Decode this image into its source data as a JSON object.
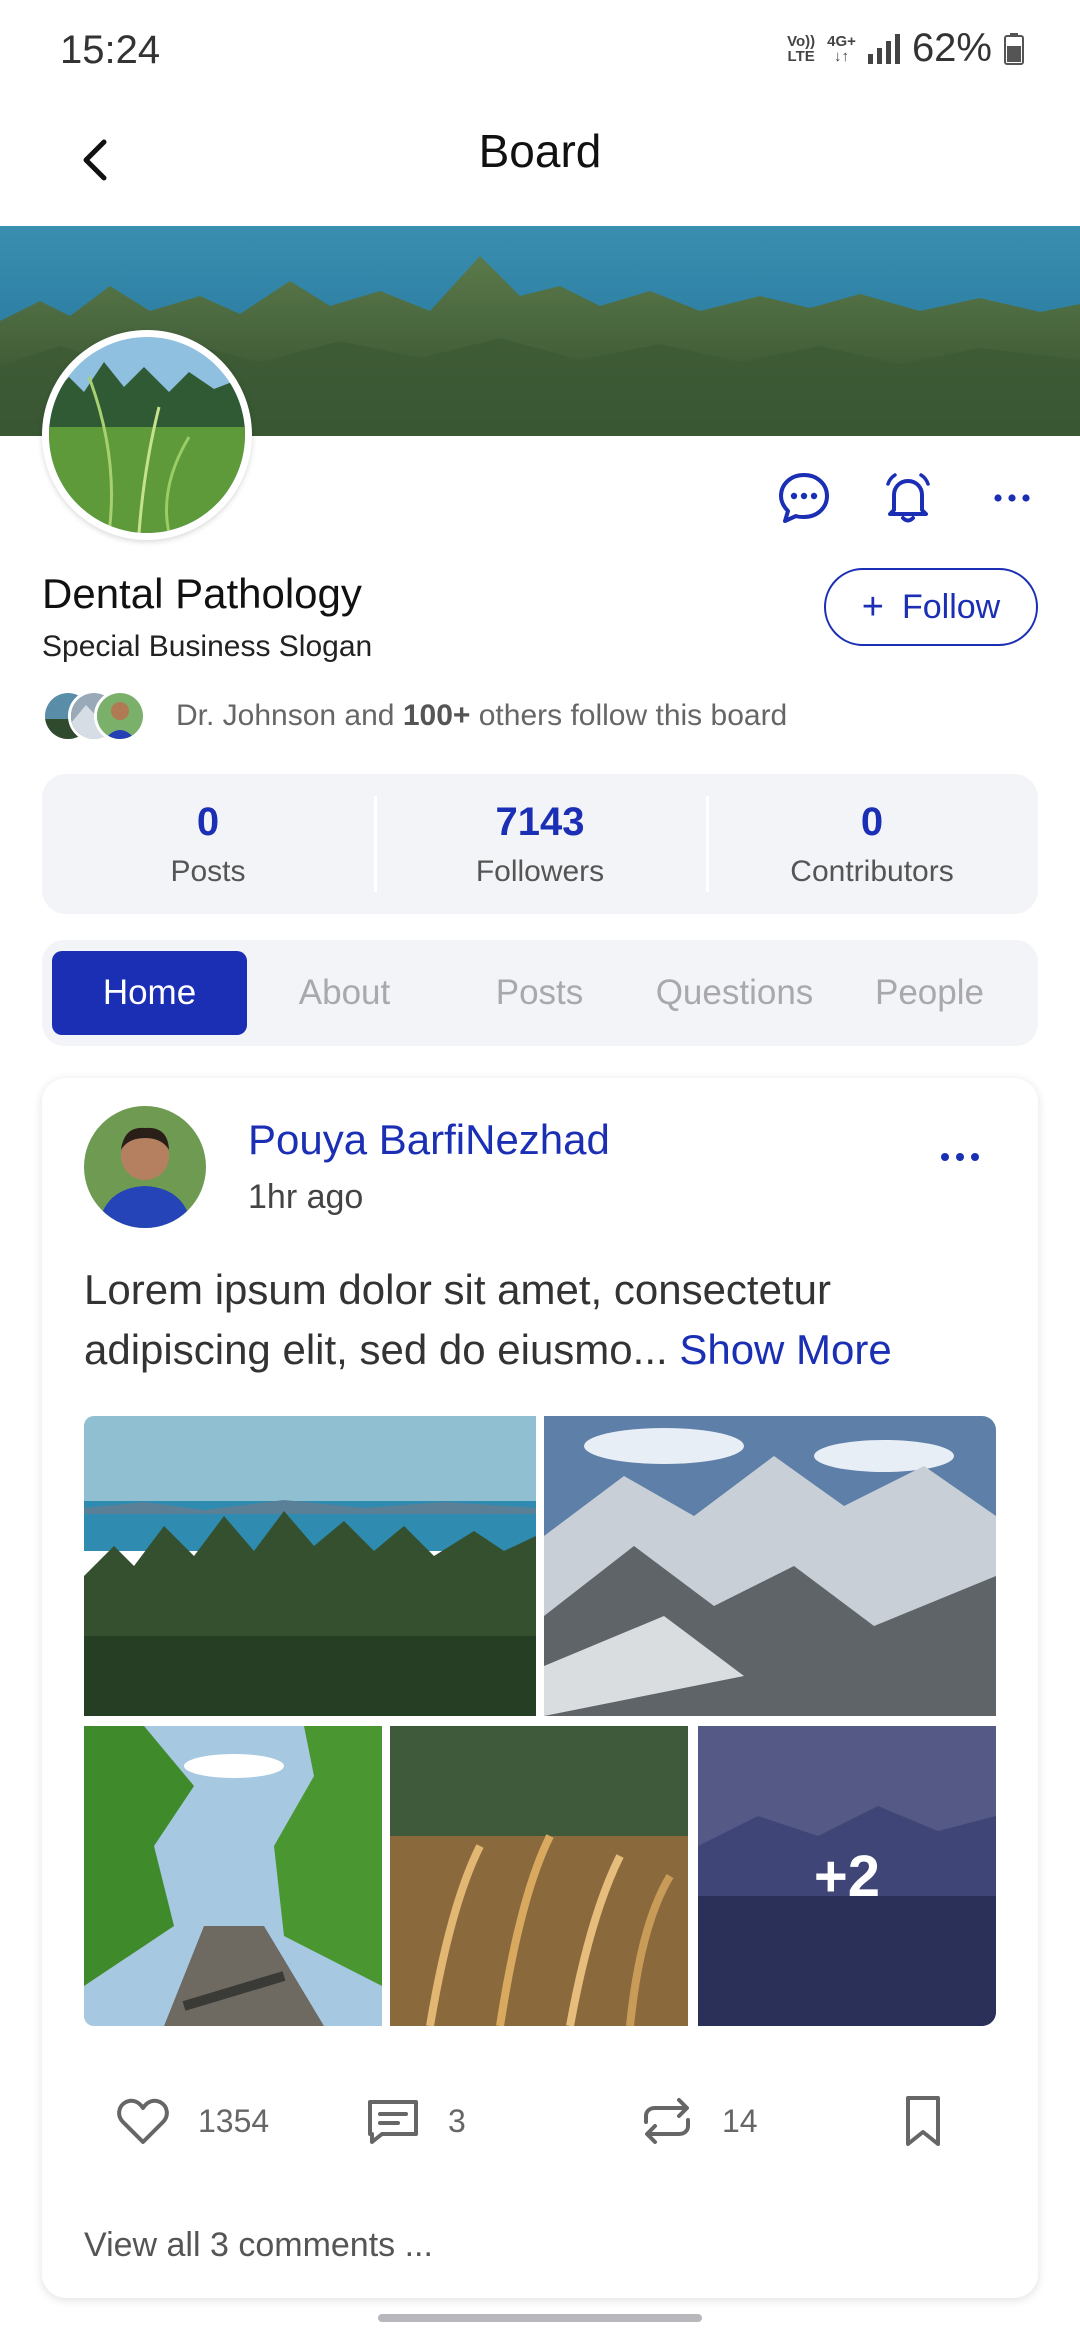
{
  "status_bar": {
    "time": "15:24",
    "volte": "Vo)) LTE",
    "network": "4G+",
    "battery": "62%"
  },
  "header": {
    "title": "Board"
  },
  "board": {
    "name": "Dental Pathology",
    "slogan": "Special Business Slogan",
    "follow_label": "Follow",
    "followers_lead": "Dr. Johnson and ",
    "followers_count_text": "100+",
    "followers_tail": " others follow this board"
  },
  "stats": [
    {
      "value": "0",
      "label": "Posts"
    },
    {
      "value": "7143",
      "label": "Followers"
    },
    {
      "value": "0",
      "label": "Contributors"
    }
  ],
  "tabs": [
    {
      "label": "Home",
      "active": true
    },
    {
      "label": "About",
      "active": false
    },
    {
      "label": "Posts",
      "active": false
    },
    {
      "label": "Questions",
      "active": false
    },
    {
      "label": "People",
      "active": false
    }
  ],
  "post": {
    "author": "Pouya BarfiNezhad",
    "time": "1hr ago",
    "text": "Lorem ipsum dolor sit amet, consectetur adipiscing elit, sed do eiusmo...",
    "show_more": "Show More",
    "more_images": "+2",
    "likes": "1354",
    "comments": "3",
    "reposts": "14",
    "view_comments": "View all 3 comments ..."
  },
  "colors": {
    "accent": "#1b2fb5",
    "panel": "#f3f4f8"
  }
}
